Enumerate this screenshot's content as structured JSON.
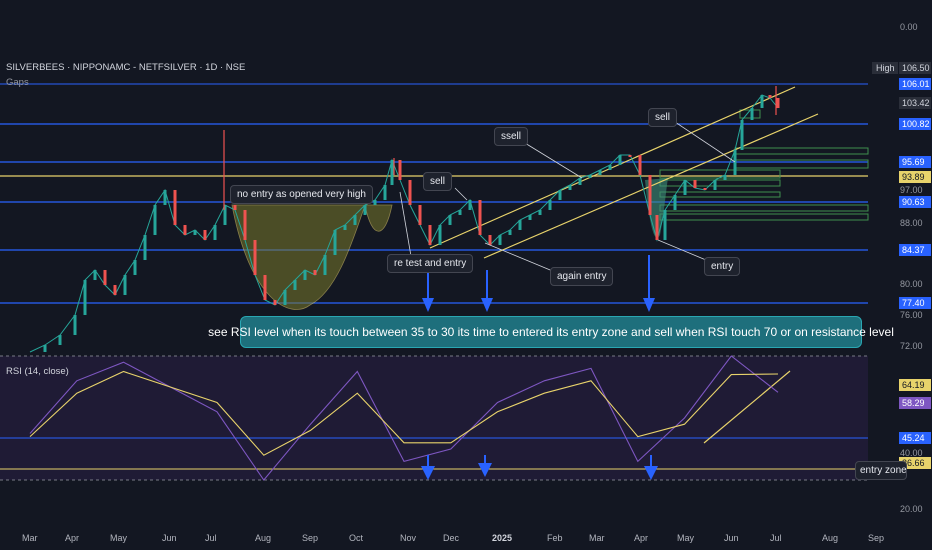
{
  "header": {
    "symbol_line": "SILVERBEES · NIPPONAMC - NETFSILVER · 1D · NSE",
    "gaps_label": "Gaps"
  },
  "price_axis": {
    "ticks": [
      "0.00",
      "100.82",
      "88.00",
      "80.00",
      "76.00",
      "72.00",
      "97.00"
    ],
    "badges": [
      {
        "label": "High",
        "bg": "#2a2e39",
        "fg": "#d1d4dc"
      },
      {
        "label": "106.50",
        "bg": "#2a2e39",
        "fg": "#d1d4dc"
      },
      {
        "label": "106.01",
        "bg": "#2962ff",
        "fg": "#ffffff"
      },
      {
        "label": "103.42",
        "bg": "#2a2e39",
        "fg": "#d1d4dc"
      },
      {
        "label": "100.82",
        "bg": "#2962ff",
        "fg": "#ffffff"
      },
      {
        "label": "95.69",
        "bg": "#2962ff",
        "fg": "#ffffff"
      },
      {
        "label": "93.89",
        "bg": "#e8d36b",
        "fg": "#131722"
      },
      {
        "label": "90.63",
        "bg": "#2962ff",
        "fg": "#ffffff"
      },
      {
        "label": "84.37",
        "bg": "#2962ff",
        "fg": "#ffffff"
      },
      {
        "label": "77.40",
        "bg": "#2962ff",
        "fg": "#ffffff"
      }
    ]
  },
  "rsi_axis": {
    "ticks": [
      "40.00",
      "20.00"
    ],
    "badges": [
      {
        "label": "64.19",
        "bg": "#e8d36b",
        "fg": "#131722"
      },
      {
        "label": "58.29",
        "bg": "#7e57c2",
        "fg": "#ffffff"
      },
      {
        "label": "45.24",
        "bg": "#2962ff",
        "fg": "#ffffff"
      },
      {
        "label": "36.66",
        "bg": "#e8d36b",
        "fg": "#131722"
      }
    ]
  },
  "time_axis": [
    "Mar",
    "Apr",
    "May",
    "Jun",
    "Jul",
    "Aug",
    "Sep",
    "Oct",
    "Nov",
    "Dec",
    "2025",
    "Feb",
    "Mar",
    "Apr",
    "May",
    "Jun",
    "Jul",
    "Aug",
    "Sep"
  ],
  "annotations": {
    "no_entry": "no entry as  opened very high",
    "sell_1": "sell",
    "ssell": "ssell",
    "sell_2": "sell",
    "retest": "re test and entry",
    "again_entry": "again entry",
    "entry": "entry",
    "banner": "see RSI level when its touch between 35 to 30 its time to entered  its entry zone and sell when RSI touch 70 or on resistance level",
    "entry_zone": "entry zone"
  },
  "rsi_label": "RSI (14, close)",
  "colors": {
    "background": "#131722",
    "up": "#26a69a",
    "down": "#ef5350",
    "level_line": "#2962ff",
    "trend_line": "#e8d36b",
    "rsi_line": "#7e57c2",
    "rsi_ma": "#e8d36b",
    "rsi_band": "#2a1f45",
    "arrow": "#2962ff"
  },
  "chart_data": [
    {
      "type": "candlestick",
      "title": "SILVERBEES · NIPPONAMC - NETFSILVER · 1D · NSE",
      "ylim": [
        70,
        108
      ],
      "horizontal_levels": [
        106.01,
        100.82,
        95.69,
        93.89,
        90.63,
        84.37,
        77.4
      ],
      "high": 106.5,
      "last": 103.42,
      "x": [
        "Mar",
        "Apr",
        "May",
        "Jun",
        "Jul",
        "Aug",
        "Sep",
        "Oct",
        "Nov",
        "Dec",
        "2025",
        "Feb",
        "Mar",
        "Apr",
        "May",
        "Jun",
        "Jul"
      ],
      "close": [
        71.5,
        75.5,
        82.5,
        91.0,
        89.0,
        78.0,
        84.0,
        94.5,
        85.0,
        86.5,
        88.5,
        92.0,
        98.0,
        86.5,
        93.0,
        104.5,
        103.4
      ]
    },
    {
      "type": "line",
      "title": "RSI (14, close)",
      "ylim": [
        20,
        75
      ],
      "levels": [
        45.24,
        36.66
      ],
      "band": [
        30,
        70
      ],
      "x": [
        "Mar",
        "Apr",
        "May",
        "Jun",
        "Jul",
        "Aug",
        "Sep",
        "Oct",
        "Nov",
        "Dec",
        "2025",
        "Feb",
        "Mar",
        "Apr",
        "May",
        "Jun",
        "Jul"
      ],
      "series": [
        {
          "values": [
            45,
            62,
            68,
            60,
            52,
            30,
            48,
            65,
            36,
            40,
            55,
            62,
            66,
            36,
            50,
            70,
            58.29
          ]
        },
        {
          "values": [
            44,
            58,
            65,
            60,
            55,
            38,
            46,
            58,
            42,
            42,
            52,
            58,
            62,
            44,
            48,
            64,
            64.19
          ]
        }
      ]
    }
  ]
}
